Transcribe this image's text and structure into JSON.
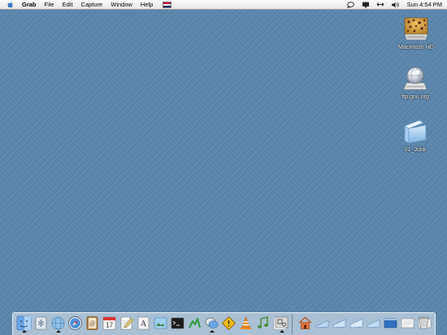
{
  "menubar": {
    "app_name": "Grab",
    "items": [
      "File",
      "Edit",
      "Capture",
      "Window",
      "Help"
    ],
    "clock": "Sun 4:54 PM"
  },
  "desktop": {
    "icons": [
      {
        "label": "Macintosh HD",
        "icon": "hard-drive-icon"
      },
      {
        "label": "ftp.gnu.org",
        "icon": "network-volume-icon"
      },
      {
        "label": "01_Junk",
        "icon": "folder-icon"
      }
    ]
  },
  "dock": {
    "apps": [
      "finder-icon",
      "system-preferences-icon",
      "network-utility-icon",
      "safari-icon",
      "address-book-icon",
      "ical-icon",
      "textedit-icon",
      "font-book-icon",
      "preview-icon",
      "terminal-icon",
      "activity-monitor-icon",
      "ichat-icon",
      "vlc-icon",
      "itunes-icon",
      "apple-icon",
      "grab-icon"
    ],
    "docs": [
      "home-folder-icon",
      "minimized-window-icon",
      "minimized-window-icon",
      "minimized-window-icon",
      "minimized-window-icon",
      "screen-icon",
      "document-icon",
      "document-icon",
      "trash-icon"
    ],
    "ical_date": "17"
  }
}
